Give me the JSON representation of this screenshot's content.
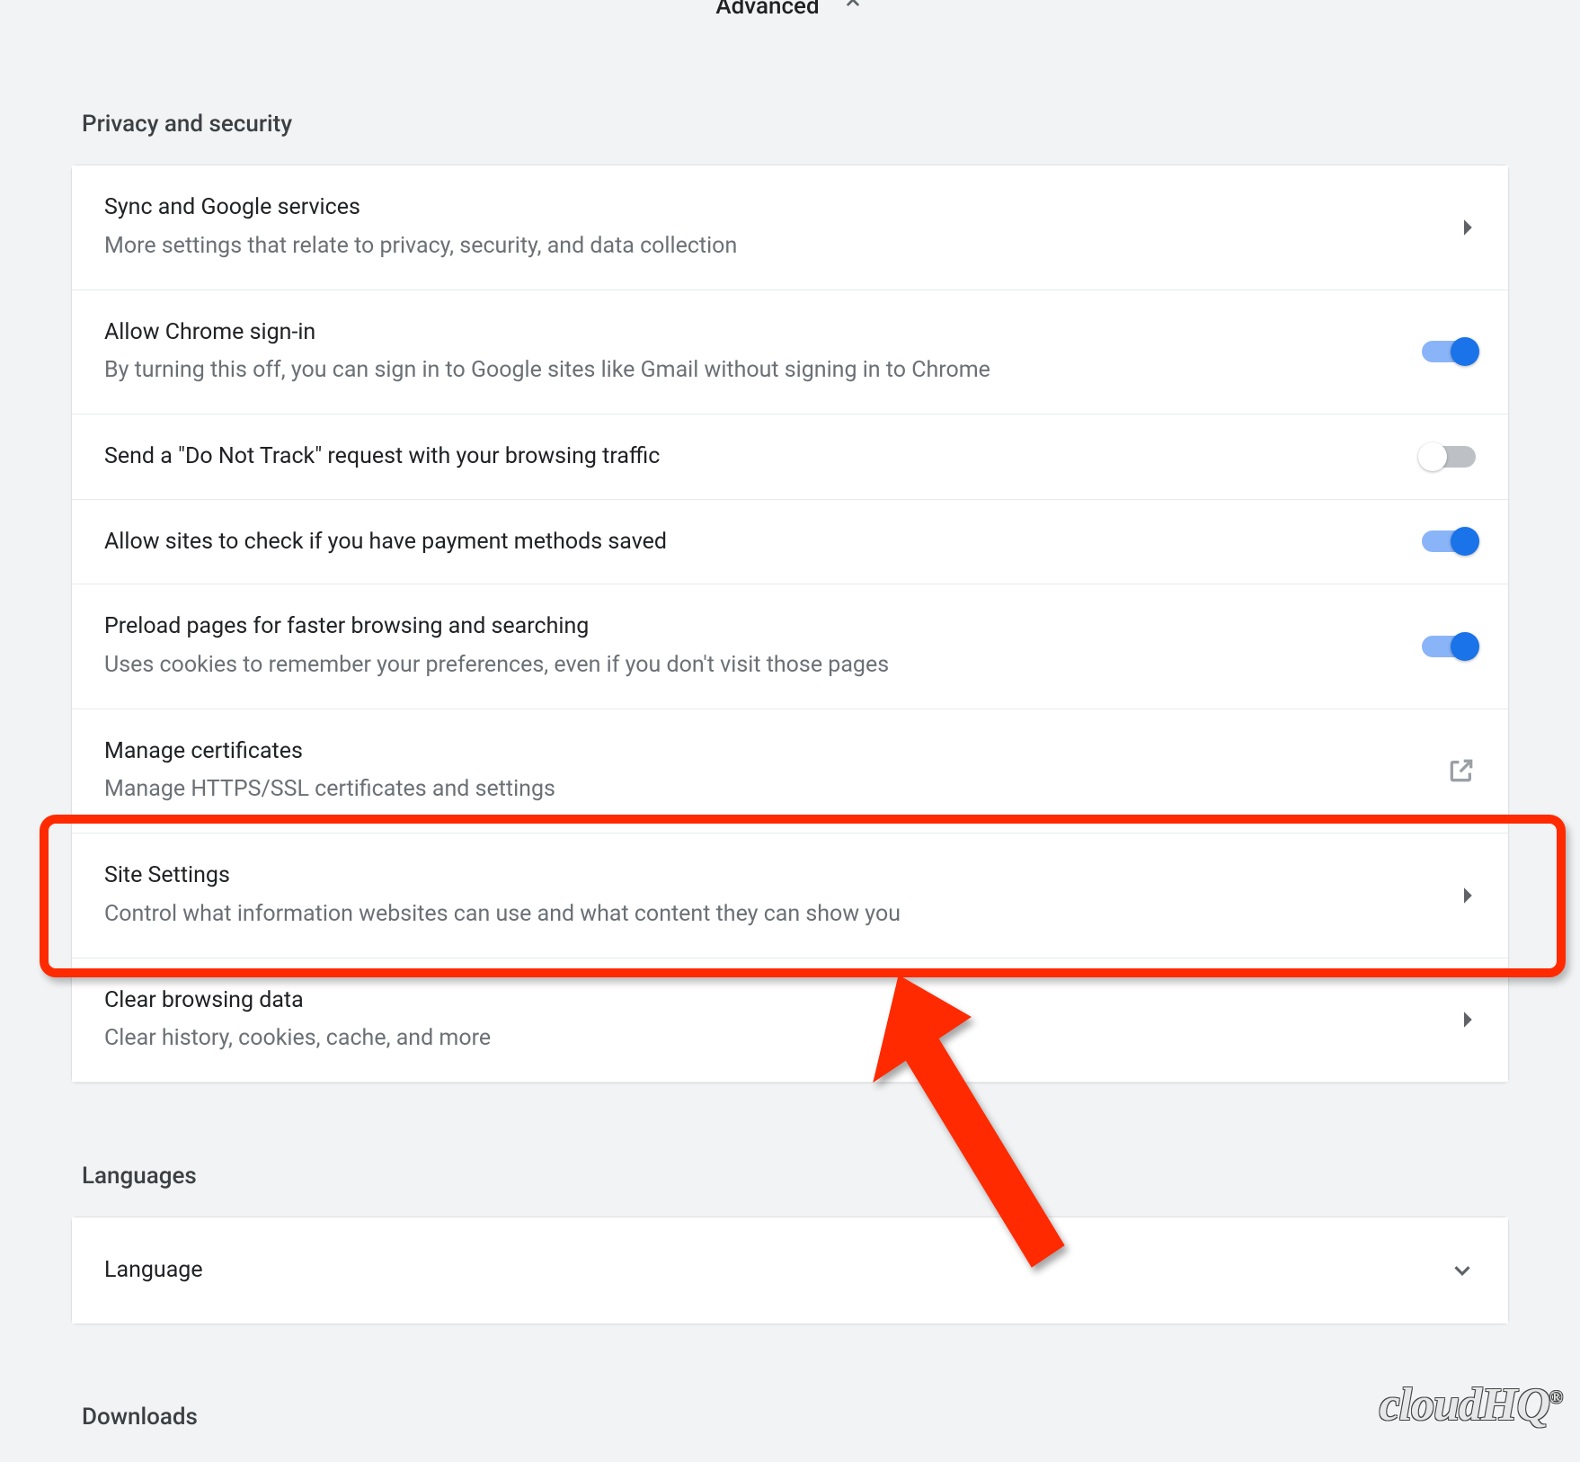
{
  "advanced_header": "Advanced",
  "sections": {
    "privacy": {
      "title": "Privacy and security",
      "rows": {
        "sync": {
          "title": "Sync and Google services",
          "desc": "More settings that relate to privacy, security, and data collection"
        },
        "signin": {
          "title": "Allow Chrome sign-in",
          "desc": "By turning this off, you can sign in to Google sites like Gmail without signing in to Chrome",
          "toggle": "on"
        },
        "dnt": {
          "title": "Send a \"Do Not Track\" request with your browsing traffic",
          "toggle": "off"
        },
        "payment": {
          "title": "Allow sites to check if you have payment methods saved",
          "toggle": "on"
        },
        "preload": {
          "title": "Preload pages for faster browsing and searching",
          "desc": "Uses cookies to remember your preferences, even if you don't visit those pages",
          "toggle": "on"
        },
        "certs": {
          "title": "Manage certificates",
          "desc": "Manage HTTPS/SSL certificates and settings"
        },
        "site": {
          "title": "Site Settings",
          "desc": "Control what information websites can use and what content they can show you"
        },
        "clear": {
          "title": "Clear browsing data",
          "desc": "Clear history, cookies, cache, and more"
        }
      }
    },
    "languages": {
      "title": "Languages",
      "row": {
        "title": "Language"
      }
    },
    "downloads": {
      "title": "Downloads"
    }
  },
  "watermark": "cloudHQ",
  "annotation": {
    "highlight_target": "site-settings-row",
    "colors": {
      "accent": "#1a73e8",
      "highlight": "#ff2a00"
    }
  }
}
